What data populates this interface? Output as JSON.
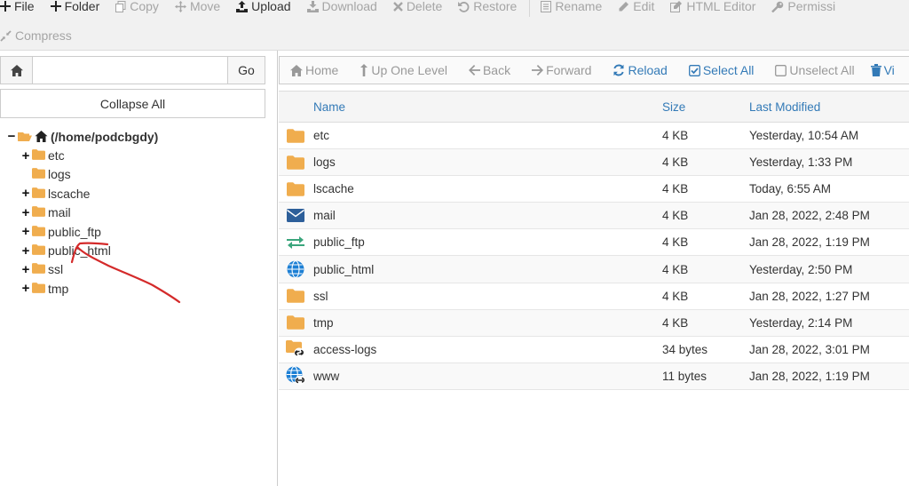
{
  "toolbar": {
    "row1": [
      {
        "label": "File",
        "icon": "plus-icon",
        "enabled": true
      },
      {
        "label": "Folder",
        "icon": "plus-icon",
        "enabled": true
      },
      {
        "label": "Copy",
        "icon": "copy-icon",
        "enabled": false
      },
      {
        "label": "Move",
        "icon": "move-icon",
        "enabled": false
      },
      {
        "label": "Upload",
        "icon": "upload-icon",
        "enabled": true
      },
      {
        "label": "Download",
        "icon": "download-icon",
        "enabled": false
      },
      {
        "label": "Delete",
        "icon": "delete-icon",
        "enabled": false
      },
      {
        "label": "Restore",
        "icon": "restore-icon",
        "enabled": false
      },
      {
        "label": "Rename",
        "icon": "rename-icon",
        "enabled": false
      },
      {
        "label": "Edit",
        "icon": "pencil-icon",
        "enabled": false
      },
      {
        "label": "HTML Editor",
        "icon": "html-editor-icon",
        "enabled": false
      },
      {
        "label": "Permissi",
        "icon": "key-icon",
        "enabled": false
      }
    ],
    "compress_label": "Compress"
  },
  "left": {
    "path_value": "",
    "go_label": "Go",
    "collapse_label": "Collapse All",
    "root_label": "(/home/podcbgdy)",
    "tree": [
      {
        "label": "etc",
        "expandable": true
      },
      {
        "label": "logs",
        "expandable": false
      },
      {
        "label": "lscache",
        "expandable": true
      },
      {
        "label": "mail",
        "expandable": true
      },
      {
        "label": "public_ftp",
        "expandable": true
      },
      {
        "label": "public_html",
        "expandable": true
      },
      {
        "label": "ssl",
        "expandable": true
      },
      {
        "label": "tmp",
        "expandable": true
      }
    ]
  },
  "nav": {
    "home": "Home",
    "up": "Up One Level",
    "back": "Back",
    "forward": "Forward",
    "reload": "Reload",
    "select_all": "Select All",
    "unselect_all": "Unselect All",
    "view": "Vi"
  },
  "table": {
    "headers": {
      "name": "Name",
      "size": "Size",
      "modified": "Last Modified"
    },
    "rows": [
      {
        "icon": "folder",
        "name": "etc",
        "size": "4 KB",
        "modified": "Yesterday, 10:54 AM"
      },
      {
        "icon": "folder",
        "name": "logs",
        "size": "4 KB",
        "modified": "Yesterday, 1:33 PM"
      },
      {
        "icon": "folder",
        "name": "lscache",
        "size": "4 KB",
        "modified": "Today, 6:55 AM"
      },
      {
        "icon": "mail",
        "name": "mail",
        "size": "4 KB",
        "modified": "Jan 28, 2022, 2:48 PM"
      },
      {
        "icon": "ftp",
        "name": "public_ftp",
        "size": "4 KB",
        "modified": "Jan 28, 2022, 1:19 PM"
      },
      {
        "icon": "globe",
        "name": "public_html",
        "size": "4 KB",
        "modified": "Yesterday, 2:50 PM"
      },
      {
        "icon": "folder",
        "name": "ssl",
        "size": "4 KB",
        "modified": "Jan 28, 2022, 1:27 PM"
      },
      {
        "icon": "folder",
        "name": "tmp",
        "size": "4 KB",
        "modified": "Yesterday, 2:14 PM"
      },
      {
        "icon": "folder-link",
        "name": "access-logs",
        "size": "34 bytes",
        "modified": "Jan 28, 2022, 3:01 PM"
      },
      {
        "icon": "globe-link",
        "name": "www",
        "size": "11 bytes",
        "modified": "Jan 28, 2022, 1:19 PM"
      }
    ]
  },
  "colors": {
    "link_blue": "#337ab7",
    "folder_orange": "#f0ad4e",
    "disabled_gray": "#a5a5a5",
    "annotation_red": "#d42a2a"
  }
}
